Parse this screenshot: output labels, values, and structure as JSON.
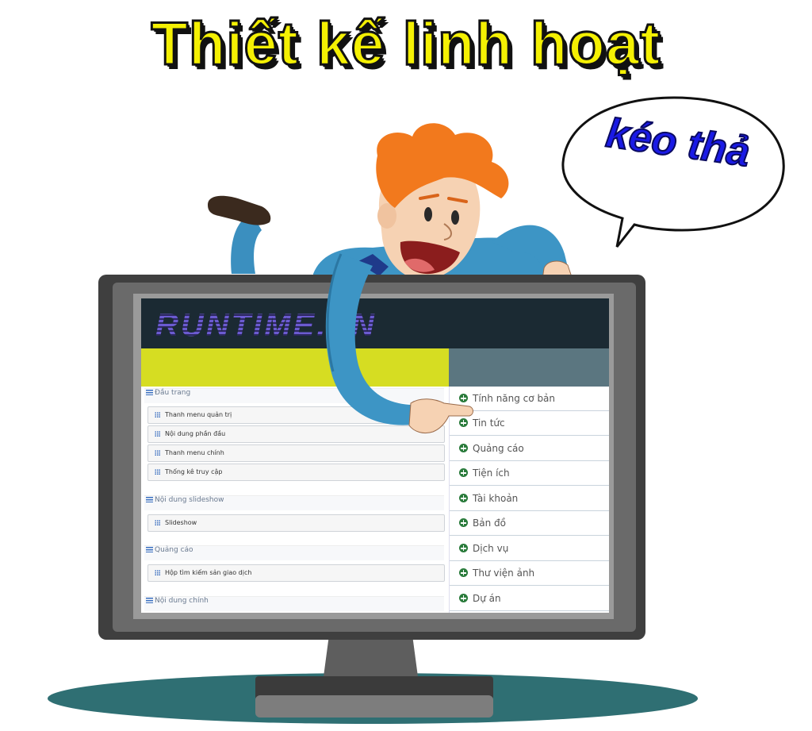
{
  "headline": "Thiết kế linh hoạt",
  "speech_bubble": "kéo thả",
  "brand": {
    "logo_text": "RUNTIME.VN"
  },
  "colors": {
    "header_bg": "#1b2a33",
    "lime_bar": "#d6dd22",
    "slate_bar": "#5b7680",
    "headline_yellow": "#f4f003",
    "bubble_blue": "#1a1ae6",
    "plus_green": "#2a7b3b"
  },
  "layout_sections": [
    {
      "title": "Đầu trang",
      "items": [
        "Thanh menu quản trị",
        "Nội dung phần đầu",
        "Thanh menu chính",
        "Thống kê truy cập"
      ]
    },
    {
      "title": "Nội dung slideshow",
      "items": [
        "Slideshow"
      ]
    },
    {
      "title": "Quảng cáo",
      "items": [
        "Hộp tìm kiếm sản giao dịch"
      ]
    },
    {
      "title": "Nội dung chính",
      "items": []
    }
  ],
  "widgets": [
    "Tính năng cơ bản",
    "Tin tức",
    "Quảng cáo",
    "Tiện ích",
    "Tài khoản",
    "Bản đồ",
    "Dịch vụ",
    "Thư viện ảnh",
    "Dự án"
  ]
}
